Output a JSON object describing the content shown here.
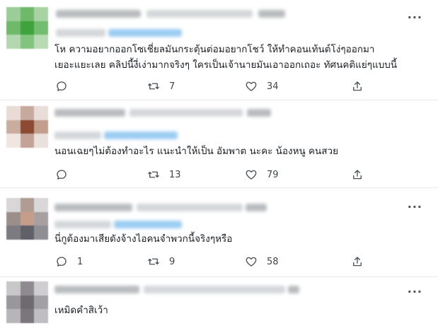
{
  "tweets": [
    {
      "text_lines": [
        "โห ความอยากออกโซเชี่ยลมันกระตุ้นต่อมอยากโชว์ ให้ทำคอนเท้นต์โง่ๆออกมา",
        "เยอะแยะเลย คลิปนี้งี่เง่ามากจริงๆ ใครเป็นเจ้านายมันเอาออกเถอะ ทัศนคติแย่ๆแบบนี้"
      ],
      "reply_count": "",
      "retweet_count": "7",
      "like_count": "34",
      "more_label": "···"
    },
    {
      "text_lines": [
        "นอนเฉยๆไม่ต้องทำอะไร แนะนำให้เป็น อัมพาต นะคะ น้องหนู คนสวย"
      ],
      "reply_count": "",
      "retweet_count": "13",
      "like_count": "79",
      "more_label": ""
    },
    {
      "text_lines": [
        "นี่กูต้องมาเสียดังจ้างไอคนจำพวกนี้จริงๆหรือ"
      ],
      "reply_count": "1",
      "retweet_count": "9",
      "like_count": "58",
      "more_label": "···"
    },
    {
      "text_lines": [
        "เหมิดคำสิเว้า"
      ],
      "more_label": "···"
    }
  ],
  "colors": {
    "icon": "#4a5158",
    "text": "#1a1f24",
    "divider": "#e6e9eb",
    "blurred_link": "#9ccdf2"
  },
  "icons": [
    "reply-icon",
    "retweet-icon",
    "like-icon",
    "share-icon",
    "more-icon"
  ]
}
